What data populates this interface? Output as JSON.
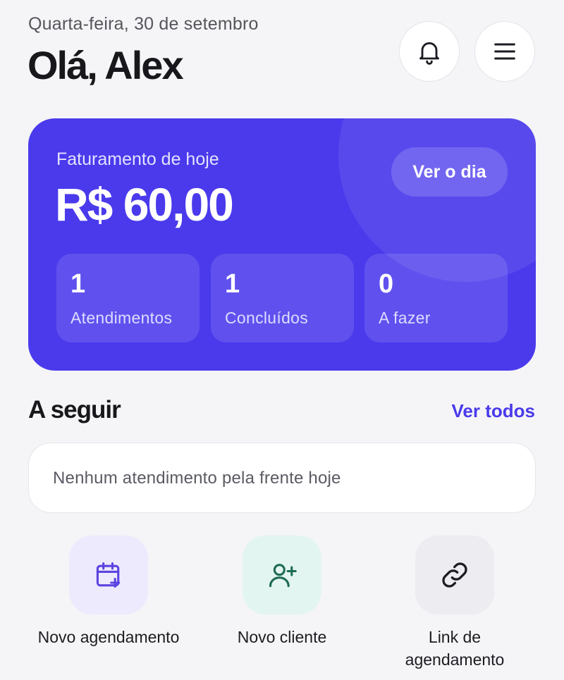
{
  "header": {
    "date": "Quarta-feira, 30 de setembro",
    "greeting": "Olá, Alex",
    "notifications_icon": "bell-icon",
    "menu_icon": "hamburger-menu-icon"
  },
  "revenue_card": {
    "label": "Faturamento de hoje",
    "amount": "R$ 60,00",
    "view_day_label": "Ver o dia",
    "background_color": "#4a3aec",
    "stats": [
      {
        "value": "1",
        "label": "Atendimentos"
      },
      {
        "value": "1",
        "label": "Concluídos"
      },
      {
        "value": "0",
        "label": "A fazer"
      }
    ]
  },
  "upcoming": {
    "title": "A seguir",
    "see_all_label": "Ver todos",
    "empty_message": "Nenhum atendimento pela frente hoje"
  },
  "quick_actions": [
    {
      "label": "Novo agendamento",
      "icon": "calendar-plus-icon",
      "tile_color": "#eeeafe",
      "icon_color": "#5b45e0"
    },
    {
      "label": "Novo cliente",
      "icon": "user-plus-icon",
      "tile_color": "#e3f5f0",
      "icon_color": "#1f6b55"
    },
    {
      "label": "Link de agendamento",
      "icon": "link-icon",
      "tile_color": "#ececf1",
      "icon_color": "#1c1c22"
    }
  ]
}
